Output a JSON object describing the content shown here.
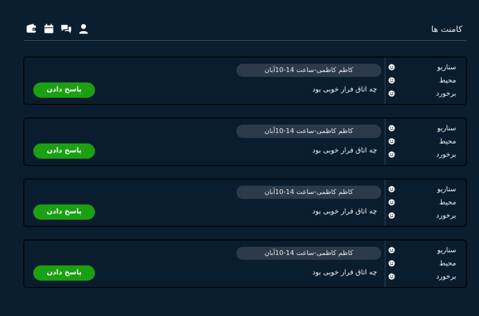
{
  "header": {
    "title": "کامنت ها",
    "icons": [
      "wallet-icon",
      "calendar-icon",
      "chat-icon",
      "user-icon"
    ]
  },
  "comments": [
    {
      "author": "کاظم کاظمی-ساعت 14-10آبان",
      "text": "چه اتاق فرار خوبی بود",
      "reply_label": "پاسخ دادن",
      "metrics": [
        {
          "label": "سناریو",
          "icon": "smiley-icon"
        },
        {
          "label": "محیط",
          "icon": "smiley-icon"
        },
        {
          "label": "برخورد",
          "icon": "smiley-icon"
        }
      ]
    },
    {
      "author": "کاظم کاظمی-ساعت 14-10آبان",
      "text": "چه اتاق فرار خوبی بود",
      "reply_label": "پاسخ دادن",
      "metrics": [
        {
          "label": "سناریو",
          "icon": "smiley-icon"
        },
        {
          "label": "محیط",
          "icon": "smiley-icon"
        },
        {
          "label": "برخورد",
          "icon": "smiley-icon"
        }
      ]
    },
    {
      "author": "کاظم کاظمی-ساعت 14-10آبان",
      "text": "چه اتاق فرار خوبی بود",
      "reply_label": "پاسخ دادن",
      "metrics": [
        {
          "label": "سناریو",
          "icon": "smiley-icon"
        },
        {
          "label": "محیط",
          "icon": "smiley-icon"
        },
        {
          "label": "برخورد",
          "icon": "smiley-icon"
        }
      ]
    },
    {
      "author": "کاظم کاظمی-ساعت 14-10آبان",
      "text": "چه اتاق فرار خوبی بود",
      "reply_label": "پاسخ دادن",
      "metrics": [
        {
          "label": "سناریو",
          "icon": "smiley-icon"
        },
        {
          "label": "محیط",
          "icon": "smiley-icon"
        },
        {
          "label": "برخورد",
          "icon": "smiley-icon"
        }
      ]
    }
  ],
  "colors": {
    "background": "#0b1e2f",
    "chip": "#2c3a4a",
    "reply_button": "#1aa012",
    "text": "#ffffff"
  }
}
